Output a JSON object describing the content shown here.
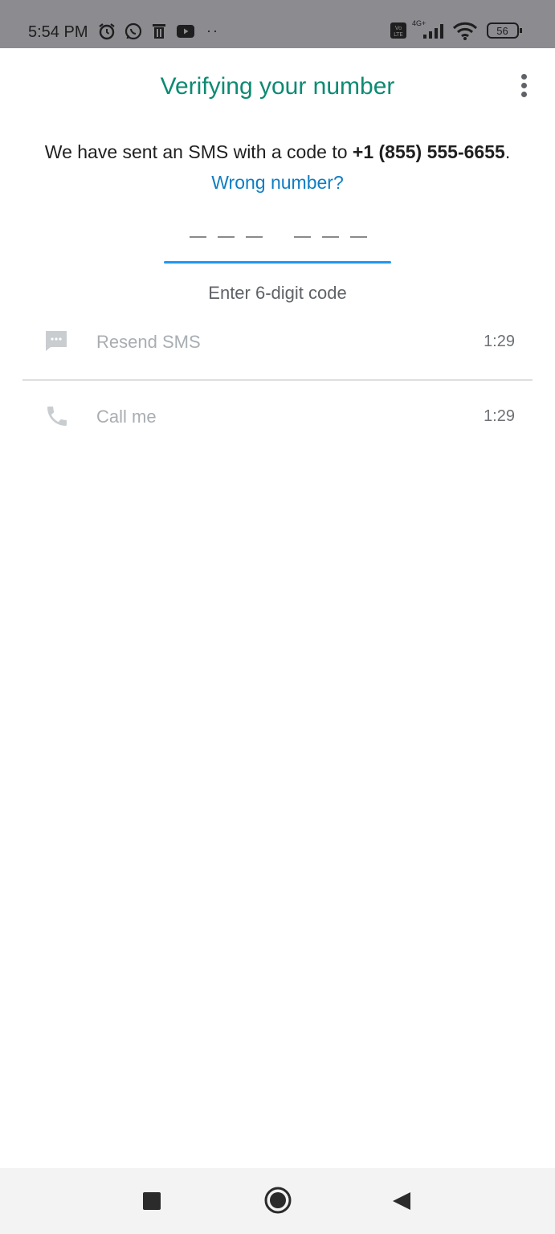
{
  "status_bar": {
    "time": "5:54 PM",
    "network": "4G+",
    "battery": "56",
    "overflow_dots": "··",
    "icons": [
      "alarm-icon",
      "whatsapp-icon",
      "delete-icon",
      "youtube-icon",
      "volte-icon",
      "signal-icon",
      "wifi-icon",
      "battery-icon"
    ]
  },
  "header": {
    "title": "Verifying your number",
    "menu_icon": "more-vert-icon"
  },
  "message": {
    "text": "We have sent an SMS with a code to ",
    "phone": "+1 (855) 555-6655",
    "suffix": ".",
    "wrong_number": "Wrong number?"
  },
  "code_input": {
    "value": "",
    "digits": 6,
    "hint": "Enter 6-digit code"
  },
  "options": [
    {
      "label": "Resend SMS",
      "timer": "1:29",
      "icon": "message-icon"
    },
    {
      "label": "Call me",
      "timer": "1:29",
      "icon": "phone-icon"
    }
  ],
  "nav_bar": {
    "buttons": [
      "recents-square-icon",
      "home-circle-icon",
      "back-triangle-icon"
    ]
  },
  "colors": {
    "status_bar": "#8b8b90",
    "title": "#0d8a72",
    "link": "#0f7dc2",
    "underline": "#2196f3",
    "disabled_text": "#a8aeb2"
  }
}
